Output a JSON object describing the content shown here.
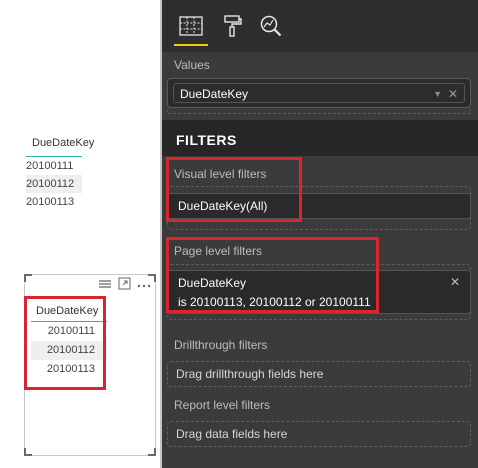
{
  "left": {
    "table1": {
      "header": "DueDateKey",
      "rows": [
        "20100111",
        "20100112",
        "20100113"
      ]
    },
    "visual": {
      "toolbar": {
        "focus_icon": "focus-mode-icon",
        "more_icon": "more-options-icon"
      },
      "table": {
        "header": "DueDateKey",
        "rows": [
          "20100111",
          "20100112",
          "20100113"
        ]
      }
    }
  },
  "pane": {
    "tabs": [
      {
        "name": "fields-icon",
        "active": true
      },
      {
        "name": "format-paint-roller-icon",
        "active": false
      },
      {
        "name": "analytics-magnifier-icon",
        "active": false
      }
    ],
    "values_label": "Values",
    "values_field": "DueDateKey",
    "filters_title": "FILTERS",
    "visual_level": {
      "label": "Visual level filters",
      "field": "DueDateKey(All)"
    },
    "page_level": {
      "label": "Page level filters",
      "field": "DueDateKey",
      "condition": "is 20100113, 20100112 or 20100111"
    },
    "drillthrough": {
      "label": "Drillthrough filters",
      "placeholder": "Drag drillthrough fields here"
    },
    "report_level": {
      "label": "Report level filters",
      "placeholder": "Drag data fields here"
    }
  },
  "colors": {
    "highlight": "#d7262d",
    "accent": "#f2c811",
    "pane_bg": "#3b3b3b",
    "table_rule": "#2bb5a8"
  }
}
